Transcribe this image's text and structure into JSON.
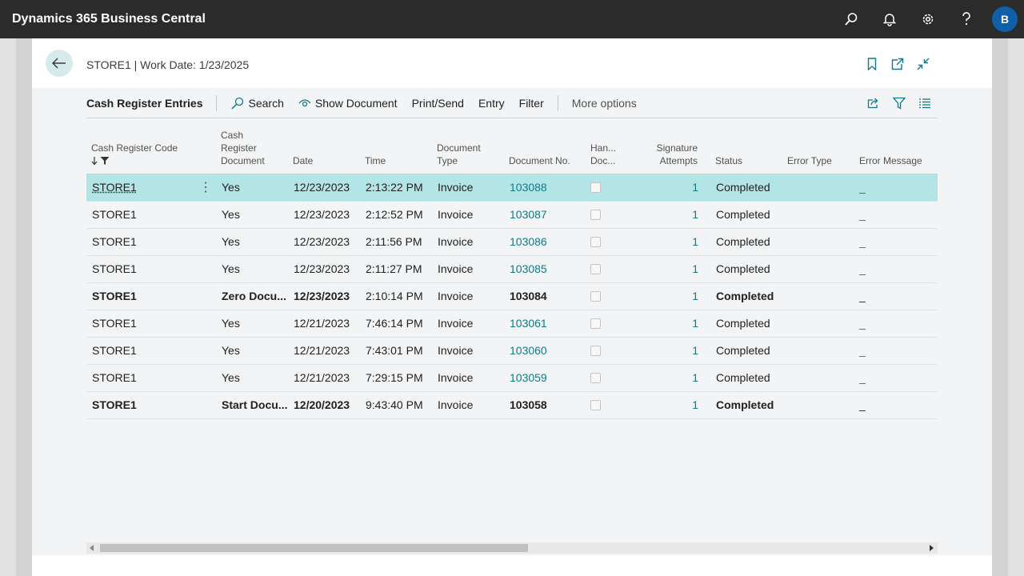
{
  "app": {
    "title": "Dynamics 365 Business Central",
    "avatar_initial": "B"
  },
  "top_icons": [
    "search-icon",
    "bell-icon",
    "gear-icon",
    "help-icon"
  ],
  "page": {
    "caption": "STORE1 | Work Date: 1/23/2025"
  },
  "actions": {
    "list_title": "Cash Register Entries",
    "search": "Search",
    "show_document": "Show Document",
    "print_send": "Print/Send",
    "entry": "Entry",
    "filter": "Filter",
    "more_options": "More options"
  },
  "columns": {
    "code_label": "Cash Register Code",
    "crd_line1": "Cash",
    "crd_line2": "Register",
    "crd_line3": "Document",
    "date": "Date",
    "time": "Time",
    "doctype_line1": "Document",
    "doctype_line2": "Type",
    "docno": "Document No.",
    "handled_line1": "Han...",
    "handled_line2": "Doc...",
    "sig_line1": "Signature",
    "sig_line2": "Attempts",
    "status": "Status",
    "error_type": "Error Type",
    "error_message": "Error Message"
  },
  "rows": [
    {
      "code": "STORE1",
      "crd": "Yes",
      "date": "12/23/2023",
      "time": "2:13:22 PM",
      "doctype": "Invoice",
      "docno": "103088",
      "sig": "1",
      "status": "Completed",
      "err": "_"
    },
    {
      "code": "STORE1",
      "crd": "Yes",
      "date": "12/23/2023",
      "time": "2:12:52 PM",
      "doctype": "Invoice",
      "docno": "103087",
      "sig": "1",
      "status": "Completed",
      "err": "_"
    },
    {
      "code": "STORE1",
      "crd": "Yes",
      "date": "12/23/2023",
      "time": "2:11:56 PM",
      "doctype": "Invoice",
      "docno": "103086",
      "sig": "1",
      "status": "Completed",
      "err": "_"
    },
    {
      "code": "STORE1",
      "crd": "Yes",
      "date": "12/23/2023",
      "time": "2:11:27 PM",
      "doctype": "Invoice",
      "docno": "103085",
      "sig": "1",
      "status": "Completed",
      "err": "_"
    },
    {
      "code": "STORE1",
      "crd": "Zero Docu...",
      "date": "12/23/2023",
      "time": "2:10:14 PM",
      "doctype": "Invoice",
      "docno": "103084",
      "sig": "1",
      "status": "Completed",
      "err": "_"
    },
    {
      "code": "STORE1",
      "crd": "Yes",
      "date": "12/21/2023",
      "time": "7:46:14 PM",
      "doctype": "Invoice",
      "docno": "103061",
      "sig": "1",
      "status": "Completed",
      "err": "_"
    },
    {
      "code": "STORE1",
      "crd": "Yes",
      "date": "12/21/2023",
      "time": "7:43:01 PM",
      "doctype": "Invoice",
      "docno": "103060",
      "sig": "1",
      "status": "Completed",
      "err": "_"
    },
    {
      "code": "STORE1",
      "crd": "Yes",
      "date": "12/21/2023",
      "time": "7:29:15 PM",
      "doctype": "Invoice",
      "docno": "103059",
      "sig": "1",
      "status": "Completed",
      "err": "_"
    },
    {
      "code": "STORE1",
      "crd": "Start Docu...",
      "date": "12/20/2023",
      "time": "9:43:40 PM",
      "doctype": "Invoice",
      "docno": "103058",
      "sig": "1",
      "status": "Completed",
      "err": "_"
    }
  ],
  "colors": {
    "accent": "#0f7b8a",
    "selected_row": "#b3e4e6",
    "topbar": "#2b2b2b"
  }
}
